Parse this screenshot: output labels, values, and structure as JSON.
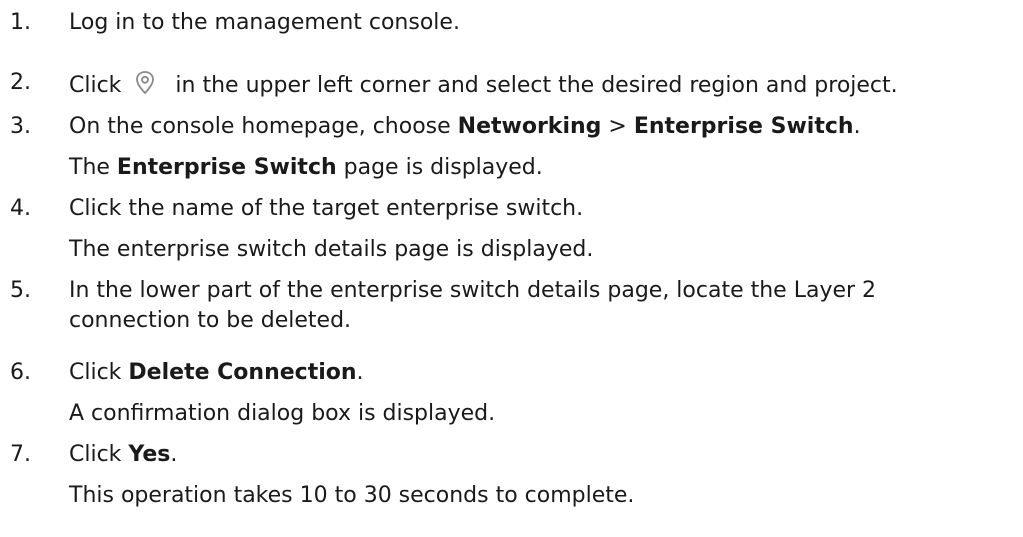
{
  "steps": [
    {
      "number": "1.",
      "text": "Log in to the management console."
    },
    {
      "number": "2.",
      "text_before": "Click",
      "icon": "location-pin-icon",
      "text_after": "in the upper left corner and select the desired region and project."
    },
    {
      "number": "3.",
      "text_before": "On the console homepage, choose ",
      "bold1": "Networking",
      "sep": " > ",
      "bold2": "Enterprise Switch",
      "end": ".",
      "result_bold": "Enterprise Switch",
      "result_rest": " page is displayed.",
      "result_the": "The "
    },
    {
      "number": "4.",
      "text": "Click the name of the target enterprise switch.",
      "result": "The enterprise switch details page is displayed."
    },
    {
      "number": "5.",
      "text_line1": "In the lower part of the enterprise switch details page, locate the Layer 2",
      "text_line2": "connection to be deleted."
    },
    {
      "number": "6.",
      "text_before": "Click ",
      "bold": "Delete Connection",
      "end": ".",
      "result": "A confirmation dialog box is displayed."
    },
    {
      "number": "7.",
      "text_before": "Click ",
      "bold": "Yes",
      "end": ".",
      "result": "This operation takes 10 to 30 seconds to complete."
    }
  ]
}
